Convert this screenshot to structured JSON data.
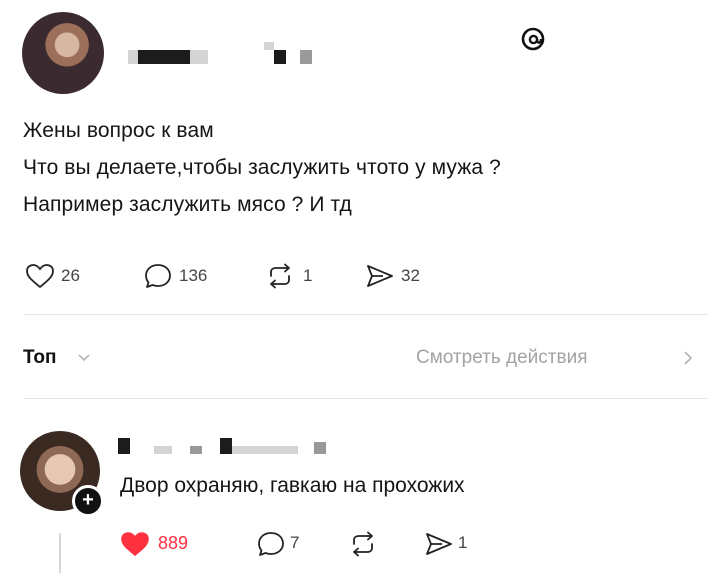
{
  "post": {
    "lines": [
      "Жены вопрос к вам",
      "Что вы делаете,чтобы заслужить чтото у мужа ?",
      "Например заслужить мясо ? И тд"
    ],
    "likes": "26",
    "comments": "136",
    "reposts": "1",
    "shares": "32"
  },
  "sort": {
    "label": "Топ",
    "view_activity": "Смотреть действия"
  },
  "reply": {
    "text": "Двор охраняю, гавкаю на прохожих",
    "likes": "889",
    "comments": "7",
    "shares": "1"
  },
  "colors": {
    "like_active": "#ff3040",
    "muted": "#a3a3a3"
  },
  "icons": [
    "threads-logo-icon",
    "heart-icon",
    "comment-icon",
    "repost-icon",
    "share-icon",
    "chevron-down-icon",
    "chevron-right-icon",
    "plus-icon"
  ]
}
